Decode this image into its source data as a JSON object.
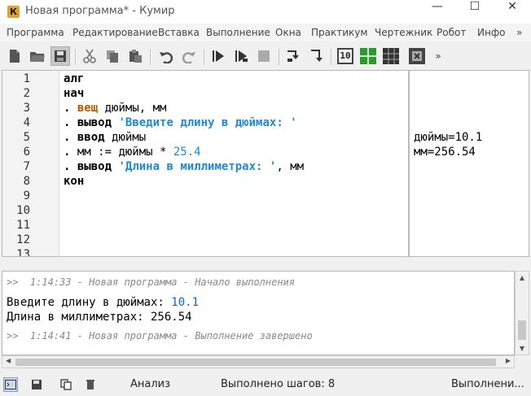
{
  "window": {
    "app_icon_letter": "К",
    "title": "Новая программа* - Кумир",
    "minimize": "—",
    "maximize": "☐",
    "close": "✕"
  },
  "menu": {
    "items": [
      "Программа",
      "Редактирование",
      "Вставка",
      "Выполнение",
      "Окна",
      "Практикум",
      "Чертежник",
      "Робот",
      "Инфо",
      "»"
    ]
  },
  "toolbar": {
    "more": "»",
    "icons": [
      "new-file-icon",
      "open-folder-icon",
      "save-icon",
      "cut-icon",
      "copy-icon",
      "paste-icon",
      "undo-icon",
      "redo-icon",
      "run-icon",
      "run-step-icon",
      "stop-icon",
      "step-into-icon",
      "step-out-icon",
      "counter-icon",
      "grid-green-icon",
      "grid-dark-icon",
      "robot-icon"
    ],
    "counter_label": "10"
  },
  "editor": {
    "line_numbers": [
      "1",
      "2",
      "3",
      "4",
      "5",
      "6",
      "7",
      "8",
      "9",
      "10",
      "11",
      "12",
      "13"
    ],
    "lines": [
      {
        "kw": "алг"
      },
      {
        "kw": "нач"
      },
      {
        "dot": ".",
        "kw_type": "вещ",
        "rest": " дюймы, мм"
      },
      {
        "dot": ".",
        "kw": "вывод",
        "str": "'Введите длину в дюймах: '"
      },
      {
        "dot": ".",
        "kw": "ввод",
        "rest": " дюймы"
      },
      {
        "dot": ".",
        "rest_pre": " мм := дюймы * ",
        "num": "25.4"
      },
      {
        "dot": ".",
        "kw": "вывод",
        "str": "'Длина в миллиметрах: '",
        "rest": ", мм"
      },
      {
        "kw": "кон"
      }
    ]
  },
  "margin": {
    "lines": [
      "дюймы=10.1",
      "мм=256.54"
    ]
  },
  "console": {
    "start_meta": ">>  1:14:33 - Новая программа - Начало выполнения",
    "prompt": "Введите длину в дюймах: ",
    "input_value": "10.1",
    "result": "Длина в миллиметрах: 256.54",
    "end_meta": ">>  1:14:41 - Новая программа - Выполнение завершено"
  },
  "statusbar": {
    "analysis": "Анализ",
    "steps": "Выполнено шагов: 8",
    "state": "Выполнени..."
  }
}
